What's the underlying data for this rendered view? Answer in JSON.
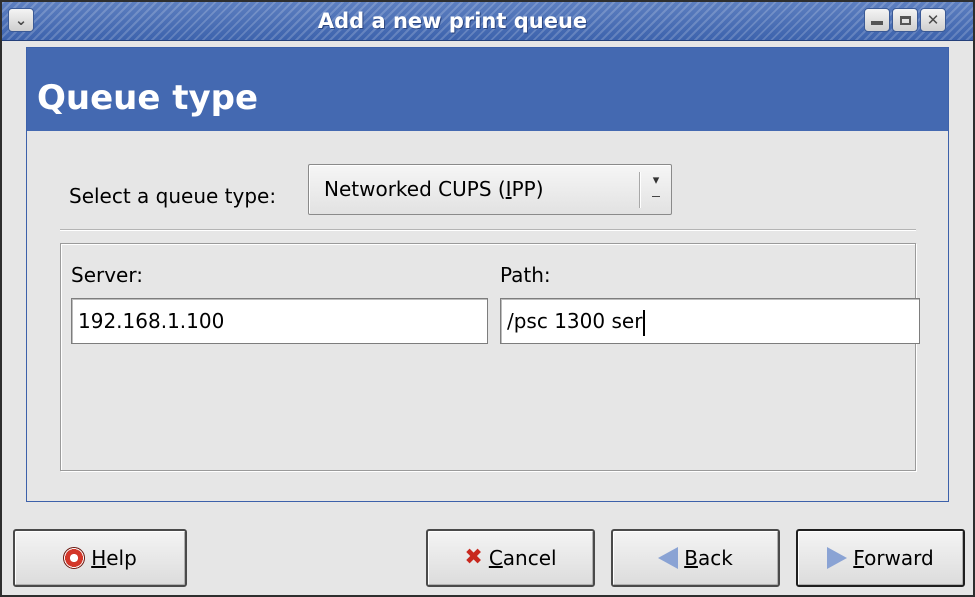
{
  "window": {
    "title": "Add a new print queue"
  },
  "druid": {
    "page_title": "Queue type"
  },
  "queue_type": {
    "label": "Select a queue type:",
    "selected": "Networked CUPS (IPP)",
    "selected_pre": "Networked CUPS (",
    "selected_mnemonic": "I",
    "selected_post": "PP)"
  },
  "fields": {
    "server_label": "Server:",
    "server_value": "192.168.1.100",
    "path_label": "Path:",
    "path_value": "/psc 1300 ser"
  },
  "buttons": {
    "help_mnemonic": "H",
    "help_rest": "elp",
    "cancel_mnemonic": "C",
    "cancel_rest": "ancel",
    "back_mnemonic": "B",
    "back_rest": "ack",
    "forward_mnemonic": "F",
    "forward_rest": "orward"
  },
  "icons": {
    "window_menu": "chevron-down-icon",
    "minimize": "minimize-icon",
    "maximize": "maximize-icon",
    "close": "close-icon",
    "help": "lifebuoy-icon",
    "cancel": "x-icon",
    "back": "left-arrow-icon",
    "forward": "right-arrow-icon",
    "combo": "dropdown-arrow-icon"
  },
  "colors": {
    "header_bg": "#4469b1",
    "titlebar_bg": "#3d63ad",
    "window_bg": "#e6e6e6"
  }
}
